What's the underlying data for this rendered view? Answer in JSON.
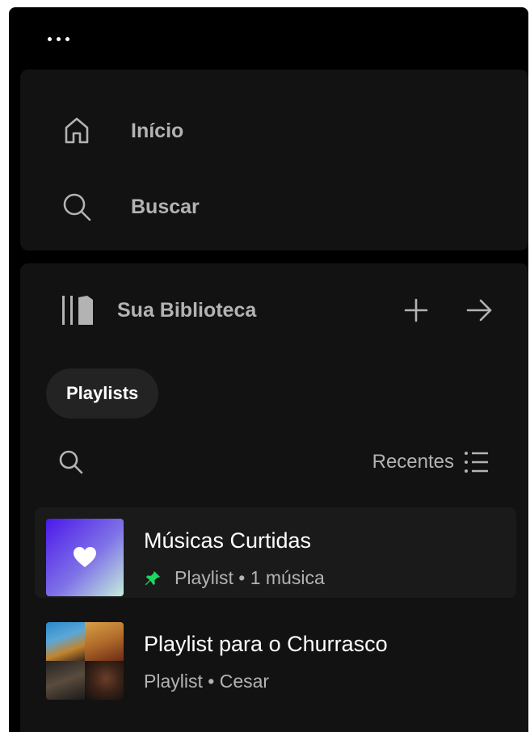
{
  "app": {
    "more_icon": "more-horizontal-icon"
  },
  "nav": {
    "items": [
      {
        "label": "Início",
        "icon": "home-icon"
      },
      {
        "label": "Buscar",
        "icon": "search-icon"
      }
    ]
  },
  "library": {
    "title": "Sua Biblioteca",
    "icon": "library-icon",
    "add_icon": "plus-icon",
    "expand_icon": "arrow-right-icon",
    "filter_chip": "Playlists",
    "search_icon": "search-icon",
    "sort_label": "Recentes",
    "sort_icon": "list-icon",
    "items": [
      {
        "title": "Músicas Curtidas",
        "type": "Playlist",
        "separator": "•",
        "detail": "1 música",
        "pinned": true,
        "pin_color": "#1ed760"
      },
      {
        "title": "Playlist para o Churrasco",
        "type": "Playlist",
        "separator": "•",
        "detail": "Cesar",
        "pinned": false
      }
    ]
  },
  "colors": {
    "background": "#000000",
    "panel": "#121212",
    "accent": "#1ed760",
    "text_primary": "#ffffff",
    "text_secondary": "#b3b3b3"
  }
}
